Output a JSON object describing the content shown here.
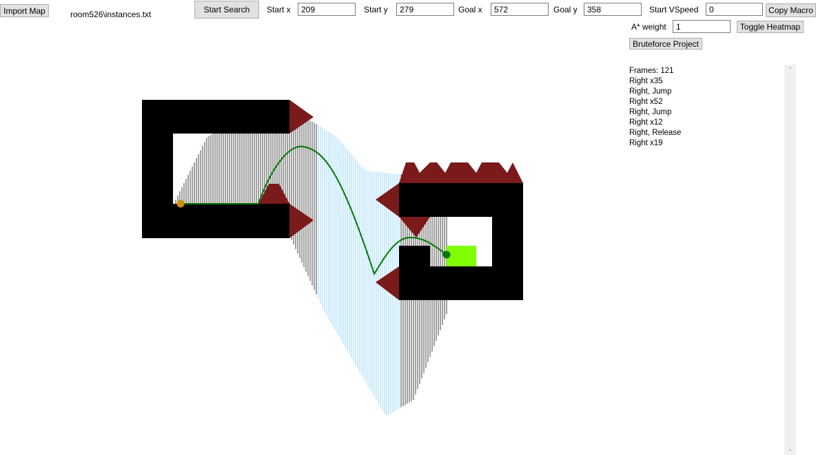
{
  "toolbar": {
    "import_map_label": "Import Map",
    "map_path": "room526\\instances.txt",
    "start_search_label": "Start Search",
    "start_x_label": "Start x",
    "start_x_value": "209",
    "start_y_label": "Start y",
    "start_y_value": "279",
    "goal_x_label": "Goal x",
    "goal_x_value": "572",
    "goal_y_label": "Goal y",
    "goal_y_value": "358",
    "start_vspeed_label": "Start VSpeed",
    "start_vspeed_value": "0",
    "copy_macro_label": "Copy Macro",
    "astar_weight_label": "A* weight",
    "astar_weight_value": "1",
    "toggle_heatmap_label": "Toggle Heatmap",
    "bruteforce_label": "Bruteforce Project"
  },
  "macro": {
    "lines": [
      "Frames: 121",
      "Right x35",
      "Right, Jump",
      "Right x52",
      "Right, Jump",
      "Right x12",
      "Right, Release",
      "Right x19"
    ]
  },
  "colors": {
    "wall": "#000000",
    "spike": "#7b1a1a",
    "goal": "#80ff00",
    "path": "#007800",
    "start_marker": "#d08c00",
    "end_marker": "#007800",
    "heatmap_line": "#000000",
    "heatmap_core": "#87cefa"
  },
  "icons": {
    "scroll_up": "chevron-up-icon",
    "scroll_down": "chevron-down-icon"
  }
}
